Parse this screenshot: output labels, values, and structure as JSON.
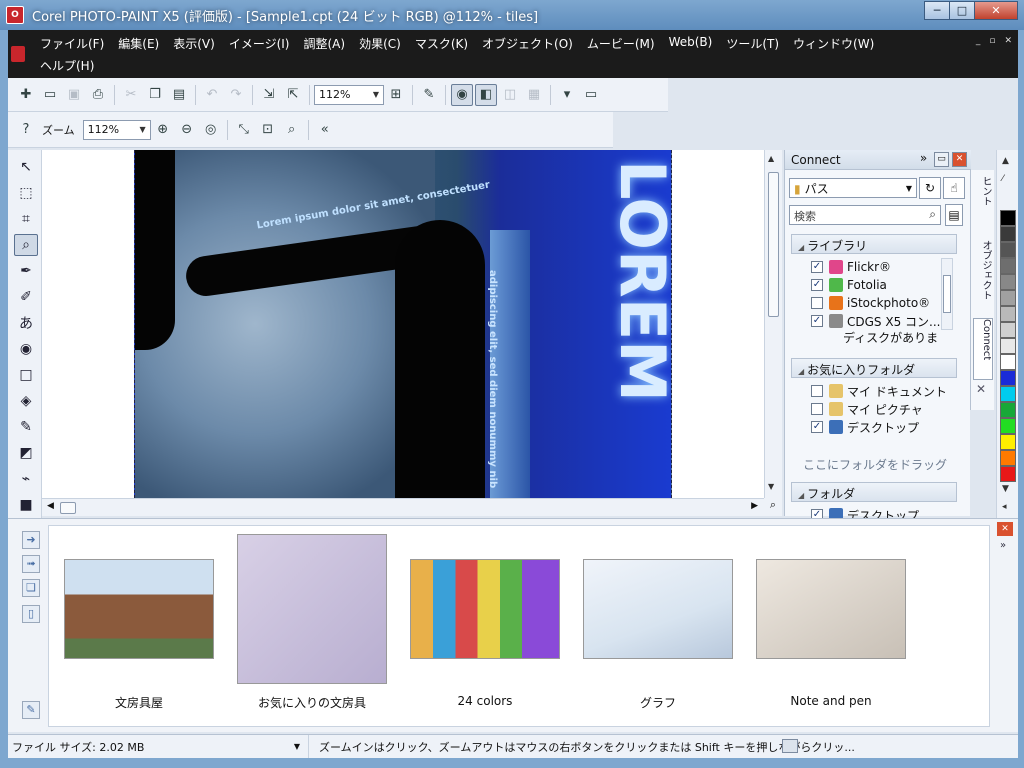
{
  "window": {
    "title": "Corel PHOTO-PAINT X5 (評価版) - [Sample1.cpt (24 ビット RGB) @112% - tiles]",
    "app_icon_text": "O",
    "minimize": "─",
    "maximize": "□",
    "close": "✕"
  },
  "menu": {
    "items": [
      "ファイル(F)",
      "編集(E)",
      "表示(V)",
      "イメージ(I)",
      "調整(A)",
      "効果(C)",
      "マスク(K)",
      "オブジェクト(O)",
      "ムービー(M)",
      "Web(B)",
      "ツール(T)",
      "ウィンドウ(W)",
      "ヘルプ(H)"
    ],
    "mdi_minimize": "_",
    "mdi_restore": "▫",
    "mdi_close": "✕"
  },
  "toolbar": {
    "zoom_combo": "112%"
  },
  "zoombar": {
    "label": "ズーム",
    "zoom_combo": "112%"
  },
  "canvas": {
    "curved_text": "Lorem ipsum dolor sit amet, consectetuer",
    "vertical_text": "adipiscing elit, sed diem nonummy nib",
    "big_text": "LOREM"
  },
  "connect": {
    "title": "Connect",
    "expand": "»",
    "path_label": "パス",
    "search_placeholder": "検索",
    "library_header": "ライブラリ",
    "library_items": [
      {
        "label": "Flickr®",
        "checked": true,
        "color": "#e0468a"
      },
      {
        "label": "Fotolia",
        "checked": true,
        "color": "#4fb84a"
      },
      {
        "label": "iStockphoto®",
        "checked": false,
        "color": "#e8731a"
      },
      {
        "label": "CDGS X5 コン...",
        "checked": true,
        "color": "#8a8a8a"
      }
    ],
    "library_note": "ディスクがありま",
    "favorites_header": "お気に入りフォルダ",
    "favorites_items": [
      {
        "label": "マイ ドキュメント",
        "checked": false,
        "color": "#e6c46a"
      },
      {
        "label": "マイ ピクチャ",
        "checked": false,
        "color": "#e6c46a"
      },
      {
        "label": "デスクトップ",
        "checked": true,
        "color": "#3c6fb8"
      }
    ],
    "favorites_hint": "ここにフォルダをドラッグ",
    "folders_header": "フォルダ",
    "folders_items": [
      {
        "label": "デスクトップ",
        "checked": true,
        "color": "#3c6fb8"
      }
    ]
  },
  "sidetabs": {
    "hint": "ヒント",
    "object": "オブジェクト",
    "connect": "Connect",
    "close": "✕"
  },
  "palette": {
    "colors": [
      "#000000",
      "#3a3a3a",
      "#555555",
      "#6e6e6e",
      "#888888",
      "#a0a0a0",
      "#b9b9b9",
      "#d0d0d0",
      "#e8e8e8",
      "#ffffff",
      "#1a2bd8",
      "#00ccee",
      "#18a838",
      "#22dd22",
      "#ffee00",
      "#ff7a00",
      "#e81818"
    ]
  },
  "tray": {
    "thumbnails": [
      {
        "caption": "文房具屋",
        "selected": false
      },
      {
        "caption": "お気に入りの文房具",
        "selected": true
      },
      {
        "caption": "24 colors",
        "selected": false
      },
      {
        "caption": "グラフ",
        "selected": false
      },
      {
        "caption": "Note and pen",
        "selected": false
      }
    ]
  },
  "status": {
    "file_size": "ファイル サイズ: 2.02 MB",
    "hint": "ズームインはクリック、ズームアウトはマウスの右ボタンをクリックまたは Shift キーを押しながらクリッ..."
  }
}
